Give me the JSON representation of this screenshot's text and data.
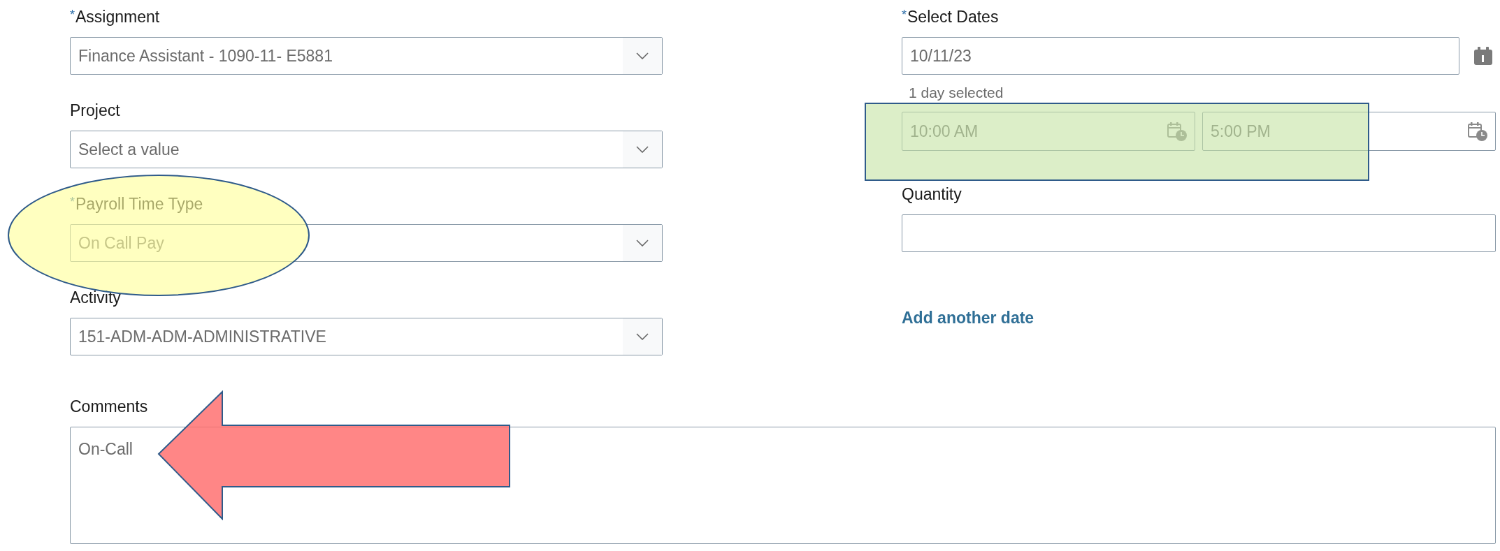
{
  "left_fields": [
    {
      "label": "Assignment",
      "required_mark": "*",
      "value": "Finance Assistant - 1090-11-  E5881",
      "kind": "select"
    },
    {
      "label": "Project",
      "placeholder": "Select a value",
      "kind": "select"
    },
    {
      "label": "Payroll Time Type",
      "required_mark": "*",
      "value": "On Call Pay",
      "kind": "select"
    },
    {
      "label": "Activity",
      "value": "151-ADM-ADM-ADMINISTRATIVE",
      "kind": "select"
    }
  ],
  "select_dates": {
    "label": "Select Dates",
    "required_mark": "*",
    "value": "10/11/23",
    "summary": "1 day selected",
    "start_time": "10:00 AM",
    "end_time": "5:00 PM"
  },
  "quantity": {
    "label": "Quantity"
  },
  "add_date_link": "Add another date",
  "comments": {
    "label": "Comments",
    "value": "On-Call"
  },
  "annotations": [
    {
      "kind": "ellipse"
    },
    {
      "kind": "rectangle"
    },
    {
      "kind": "arrow"
    }
  ]
}
